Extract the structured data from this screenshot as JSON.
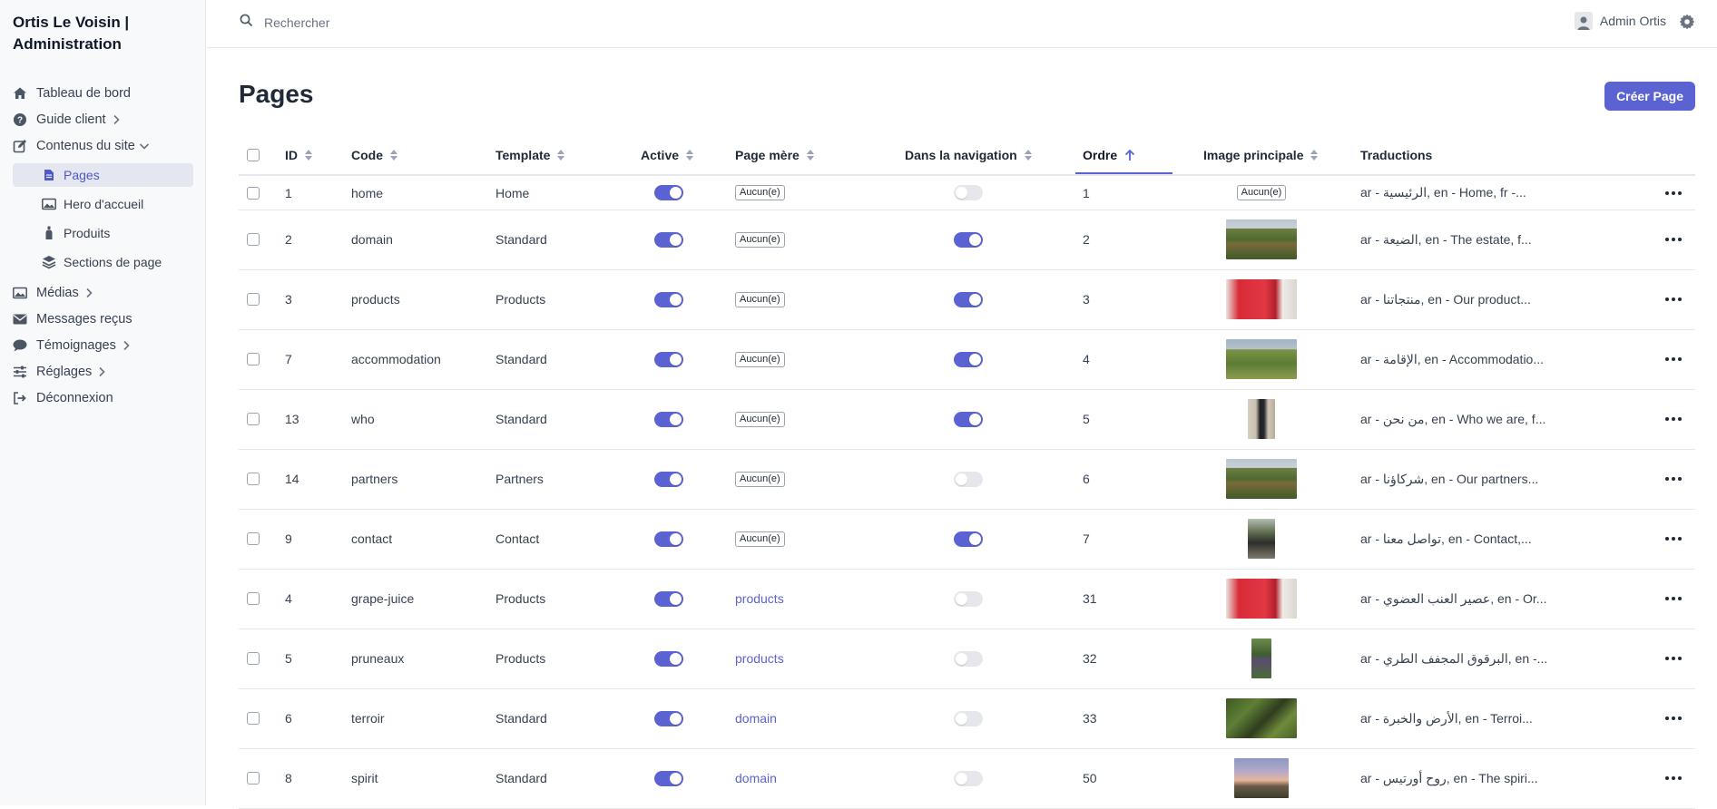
{
  "app": {
    "title": "Ortis Le Voisin | Administration"
  },
  "sidebar": {
    "items": [
      {
        "label": "Tableau de bord",
        "icon": "home-icon"
      },
      {
        "label": "Guide client",
        "icon": "help-circle-icon"
      },
      {
        "label": "Contenus du site",
        "icon": "edit-icon"
      },
      {
        "label": "Pages",
        "icon": "file-icon"
      },
      {
        "label": "Hero d'accueil",
        "icon": "image-icon"
      },
      {
        "label": "Produits",
        "icon": "bottle-icon"
      },
      {
        "label": "Sections de page",
        "icon": "layers-icon"
      },
      {
        "label": "Médias",
        "icon": "images-icon"
      },
      {
        "label": "Messages reçus",
        "icon": "envelope-icon"
      },
      {
        "label": "Témoignages",
        "icon": "comment-icon"
      },
      {
        "label": "Réglages",
        "icon": "sliders-icon"
      },
      {
        "label": "Déconnexion",
        "icon": "logout-icon"
      }
    ]
  },
  "topbar": {
    "search_placeholder": "Rechercher",
    "user_name": "Admin Ortis"
  },
  "page": {
    "title": "Pages",
    "create_label": "Créer Page"
  },
  "table": {
    "columns": [
      "ID",
      "Code",
      "Template",
      "Active",
      "Page mère",
      "Dans la navigation",
      "Ordre",
      "Image principale",
      "Traductions"
    ],
    "sorted_column": "Ordre",
    "accent_color": "#5b63d3",
    "rows": [
      {
        "id": "1",
        "code": "home",
        "template": "Home",
        "active": true,
        "parent": "Aucun(e)",
        "parent_is_link": false,
        "nav": false,
        "order": "1",
        "image": "none",
        "image_label": "Aucun(e)",
        "translations": "ar - الرئيسية, en - Home, fr -..."
      },
      {
        "id": "2",
        "code": "domain",
        "template": "Standard",
        "active": true,
        "parent": "Aucun(e)",
        "parent_is_link": false,
        "nav": true,
        "order": "2",
        "image": "vineyard",
        "image_label": "",
        "translations": "ar - الضيعة, en - The estate, f..."
      },
      {
        "id": "3",
        "code": "products",
        "template": "Products",
        "active": true,
        "parent": "Aucun(e)",
        "parent_is_link": false,
        "nav": true,
        "order": "3",
        "image": "red-bag",
        "image_label": "",
        "translations": "ar - منتجاتنا, en - Our product..."
      },
      {
        "id": "7",
        "code": "accommodation",
        "template": "Standard",
        "active": true,
        "parent": "Aucun(e)",
        "parent_is_link": false,
        "nav": true,
        "order": "4",
        "image": "green-field",
        "image_label": "",
        "translations": "ar - الإقامة, en - Accommodatio..."
      },
      {
        "id": "13",
        "code": "who",
        "template": "Standard",
        "active": true,
        "parent": "Aucun(e)",
        "parent_is_link": false,
        "nav": true,
        "order": "5",
        "image": "portrait",
        "image_label": "",
        "translations": "ar - من نحن, en - Who we are, f..."
      },
      {
        "id": "14",
        "code": "partners",
        "template": "Partners",
        "active": true,
        "parent": "Aucun(e)",
        "parent_is_link": false,
        "nav": false,
        "order": "6",
        "image": "vineyard",
        "image_label": "",
        "translations": "ar - شركاؤنا, en - Our partners..."
      },
      {
        "id": "9",
        "code": "contact",
        "template": "Contact",
        "active": true,
        "parent": "Aucun(e)",
        "parent_is_link": false,
        "nav": true,
        "order": "7",
        "image": "portrait-tree",
        "image_label": "",
        "translations": "ar - تواصل معنا, en - Contact,..."
      },
      {
        "id": "4",
        "code": "grape-juice",
        "template": "Products",
        "active": true,
        "parent": "products",
        "parent_is_link": true,
        "nav": false,
        "order": "31",
        "image": "red-bag",
        "image_label": "",
        "translations": "ar - عصير العنب العضوي, en - Or..."
      },
      {
        "id": "5",
        "code": "pruneaux",
        "template": "Products",
        "active": true,
        "parent": "products",
        "parent_is_link": true,
        "nav": false,
        "order": "32",
        "image": "plum-tree",
        "image_label": "",
        "translations": "ar - البرقوق المجفف الطري, en -..."
      },
      {
        "id": "6",
        "code": "terroir",
        "template": "Standard",
        "active": true,
        "parent": "domain",
        "parent_is_link": true,
        "nav": false,
        "order": "33",
        "image": "grapes",
        "image_label": "",
        "translations": "ar - الأرض والخبرة, en - Terroi..."
      },
      {
        "id": "8",
        "code": "spirit",
        "template": "Standard",
        "active": true,
        "parent": "domain",
        "parent_is_link": true,
        "nav": false,
        "order": "50",
        "image": "sunset",
        "image_label": "",
        "translations": "ar - روح أورتيس, en - The spiri..."
      }
    ]
  }
}
